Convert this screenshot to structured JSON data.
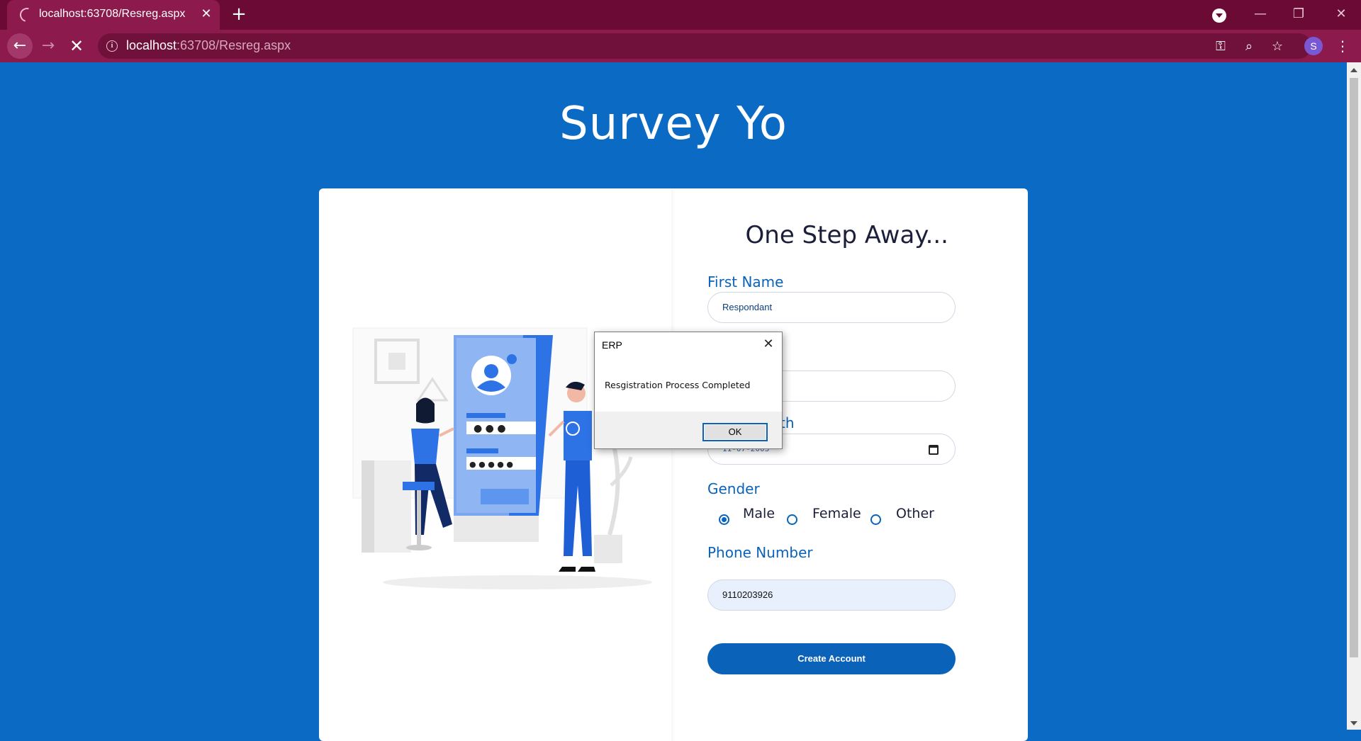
{
  "browser": {
    "tab_title": "localhost:63708/Resreg.aspx",
    "new_tab_icon": "plus-icon",
    "url_host": "localhost",
    "url_path": ":63708/Resreg.aspx",
    "profile_initial": "S",
    "accent_color": "#8c1a4c",
    "frame_color": "#6b0b35"
  },
  "page": {
    "site_title": "Survey Yo",
    "background_color": "#0a6ac4"
  },
  "form": {
    "heading": "One Step Away...",
    "first_name_label": "First Name",
    "first_name_value": "Respondant",
    "dob_label_partial": "th",
    "dob_value": "11-07-2003",
    "gender_label": "Gender",
    "gender_options": [
      "Male",
      "Female",
      "Other"
    ],
    "gender_selected": "Male",
    "phone_label": "Phone Number",
    "phone_value": "9110203926",
    "submit_label": "Create Account",
    "primary_color": "#0a63b8"
  },
  "dialog": {
    "title": "ERP",
    "message": "Resgistration Process Completed",
    "ok_label": "OK"
  }
}
